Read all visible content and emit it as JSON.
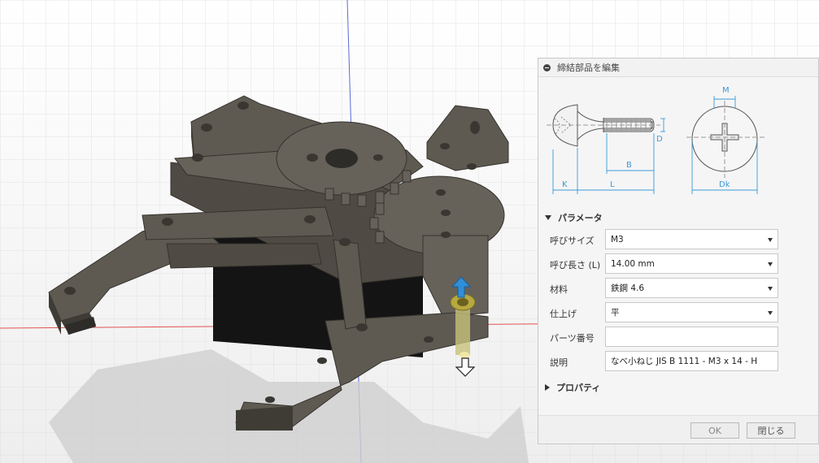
{
  "panel": {
    "title": "締結部品を編集",
    "parameters_section": "パラメータ",
    "properties_section": "プロパティ",
    "fields": [
      {
        "label": "呼びサイズ",
        "value": "M3",
        "type": "select"
      },
      {
        "label": "呼び長さ (L)",
        "value": "14.00 mm",
        "type": "select"
      },
      {
        "label": "材料",
        "value": "鉄鋼 4.6",
        "type": "select"
      },
      {
        "label": "仕上げ",
        "value": "平",
        "type": "select"
      },
      {
        "label": "パーツ番号",
        "value": "",
        "type": "input"
      },
      {
        "label": "説明",
        "value": "なべ小ねじ JIS B 1111 - M3 x 14 - H",
        "type": "input"
      }
    ],
    "ok_label": "OK",
    "close_label": "閉じる"
  },
  "diagram": {
    "labels": {
      "M": "M",
      "D": "D",
      "B": "B",
      "K": "K",
      "L": "L",
      "Dk": "Dk"
    },
    "dimension_color": "#3a9ad9"
  },
  "colors": {
    "part_face": "#5e5a52",
    "part_side": "#46433d",
    "grid": "#d8d8d8",
    "axis_red": "#e45050",
    "axis_blue": "#5c6bd6",
    "manipulator_blue": "#2f8fd8"
  }
}
